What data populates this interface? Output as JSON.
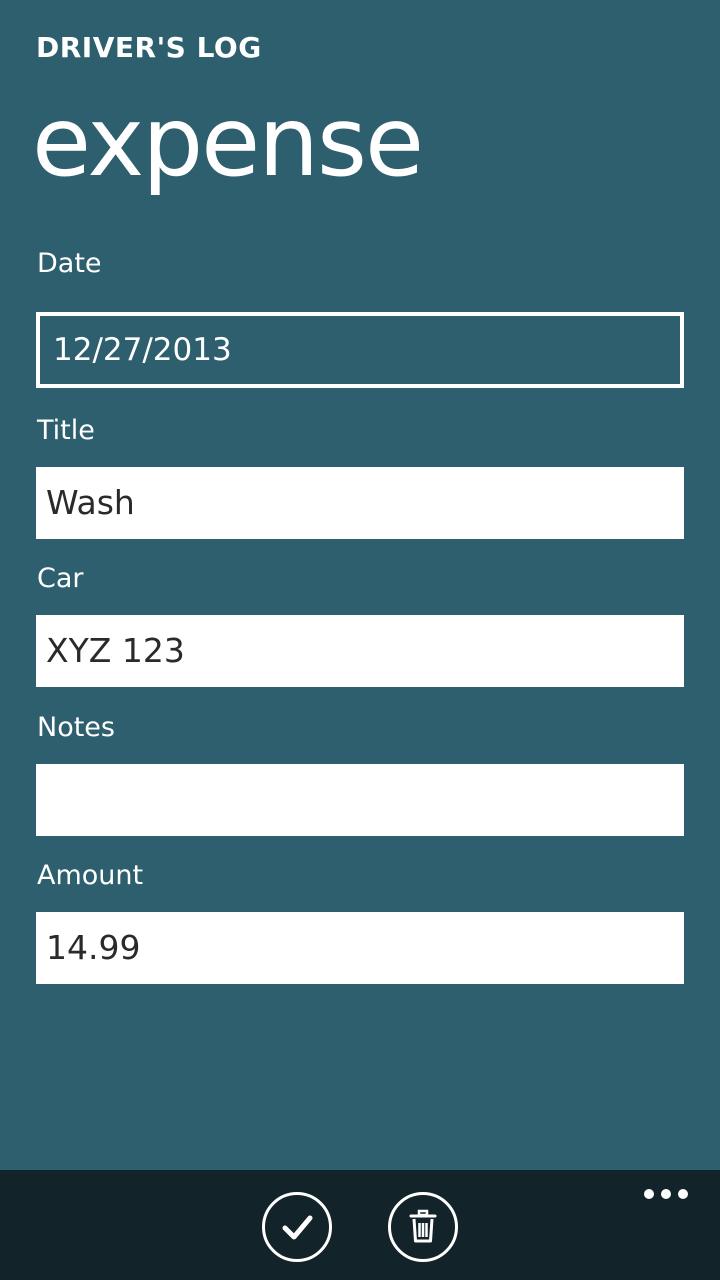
{
  "header": {
    "app_title": "DRIVER'S LOG",
    "page_title": "expense"
  },
  "form": {
    "date": {
      "label": "Date",
      "value": "12/27/2013"
    },
    "title": {
      "label": "Title",
      "value": "Wash"
    },
    "car": {
      "label": "Car",
      "value": "XYZ 123"
    },
    "notes": {
      "label": "Notes",
      "value": ""
    },
    "amount": {
      "label": "Amount",
      "value": "14.99"
    }
  },
  "app_bar": {
    "buttons": [
      {
        "icon": "check-icon"
      },
      {
        "icon": "trash-icon"
      }
    ],
    "more_icon": "ellipsis-icon"
  },
  "colors": {
    "background": "#2d5f6e",
    "app_bar": "#13232a",
    "field": "#ffffff",
    "field_text": "#2a2a2a"
  }
}
